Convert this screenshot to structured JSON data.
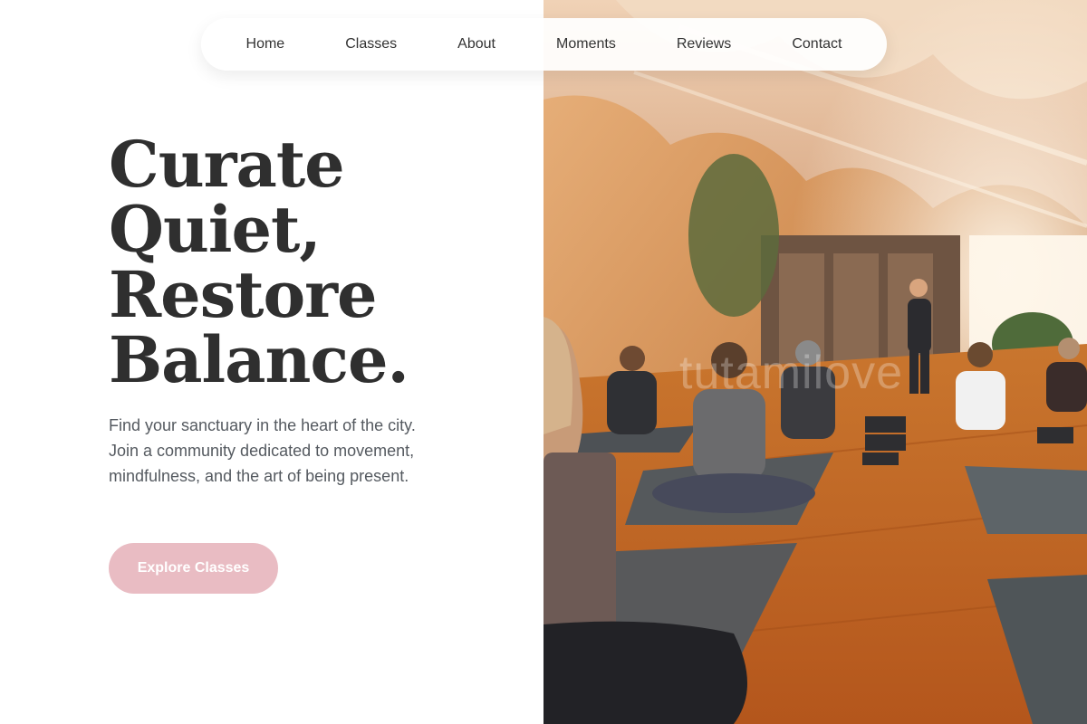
{
  "nav": {
    "items": [
      {
        "label": "Home"
      },
      {
        "label": "Classes"
      },
      {
        "label": "About"
      },
      {
        "label": "Moments"
      },
      {
        "label": "Reviews"
      },
      {
        "label": "Contact"
      }
    ]
  },
  "hero": {
    "headline_lines": [
      "Curate",
      "Quiet,",
      "Restore",
      "Balance."
    ],
    "subtext": "Find your sanctuary in the heart of the city. Join a community dedicated to movement, mindfulness, and the art of being present.",
    "cta_label": "Explore Classes",
    "image_alt": "Yoga class in a warm studio with draped ceiling fabric",
    "watermark": "tutamilove"
  },
  "colors": {
    "accent": "#e9bcc3",
    "heading": "#2f2f2f",
    "body_text": "#555a60"
  }
}
